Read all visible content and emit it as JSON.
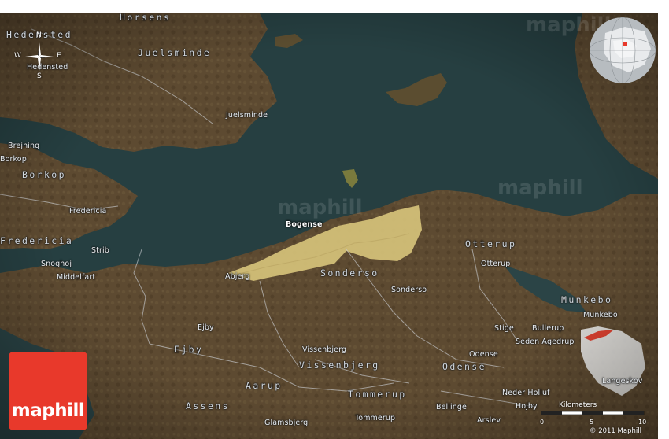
{
  "map": {
    "type": "satellite 3D map",
    "highlighted_area": "Bogense",
    "labels": {
      "horsens": "Horsens",
      "hedensted_region": "Hedensted",
      "hedensted_town": "Hedensted",
      "juelsminde_region": "Juelsminde",
      "juelsminde_town": "Juelsminde",
      "brejning": "Brejning",
      "borkop_town": "Borkop",
      "borkop_region": "Borkop",
      "fredericia_town": "Fredericia",
      "fredericia_region": "Fredericia",
      "strib": "Strib",
      "snoghoj": "Snoghoj",
      "middelfart": "Middelfart",
      "bogense": "Bogense",
      "abjerg": "Abjerg",
      "sonderso_region": "Sonderso",
      "sonderso_town": "Sonderso",
      "otterup_region": "Otterup",
      "otterup_town": "Otterup",
      "munkebo_region": "Munkebo",
      "munkebo_town": "Munkebo",
      "ejby_town": "Ejby",
      "ejby_region": "Ejby",
      "vissenbjerg_town": "Vissenbjerg",
      "vissenbjerg_region": "Vissenbjerg",
      "aarup": "Aarup",
      "assens": "Assens",
      "tommerup_region": "Tommerup",
      "tommerup_town": "Tommerup",
      "glamsbjerg": "Glamsbjerg",
      "stige": "Stige",
      "bullerup": "Bullerup",
      "seden_agedrup": "Seden Agedrup",
      "odense_town": "Odense",
      "odense_region": "Odense",
      "neder_holluf": "Neder Holluf",
      "hojby": "Hojby",
      "bellinge": "Bellinge",
      "arslev": "Arslev",
      "langeskov": "Langeskov"
    },
    "watermark": "maphill"
  },
  "compass": {
    "n": "N",
    "s": "S",
    "e": "E",
    "w": "W"
  },
  "logo": {
    "text": "maphill"
  },
  "scale": {
    "title": "Kilometers",
    "ticks": [
      "0",
      "5",
      "10"
    ]
  },
  "copyright": "© 2011 Maphill",
  "colors": {
    "water": "#233c3e",
    "land": "#5e4a31",
    "highlight": "#d8c57a",
    "logo": "#e8392b"
  }
}
